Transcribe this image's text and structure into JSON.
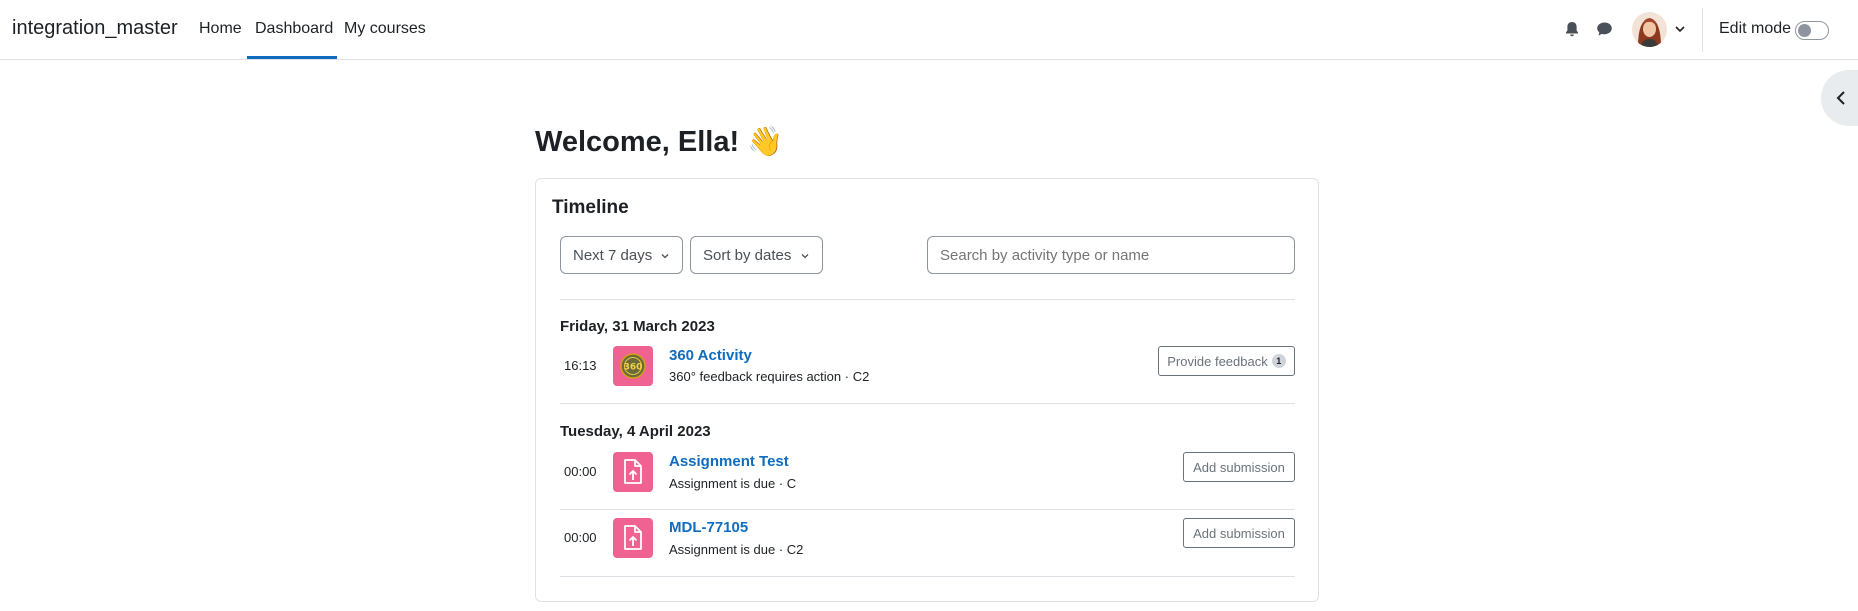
{
  "navbar": {
    "brand": "integration_master",
    "links": [
      "Home",
      "Dashboard",
      "My courses"
    ],
    "active_link": "Dashboard",
    "edit_mode_label": "Edit mode",
    "edit_mode_on": false
  },
  "main": {
    "welcome": "Welcome, Ella! 👋"
  },
  "timeline": {
    "title": "Timeline",
    "filter_days": "Next 7 days",
    "sort_by": "Sort by dates",
    "search_placeholder": "Search by activity type or name",
    "groups": [
      {
        "date": "Friday, 31 March 2023",
        "items": [
          {
            "time": "16:13",
            "icon": "360-feedback-icon",
            "name": "360 Activity",
            "description": "360° feedback requires action · C2",
            "action": "Provide feedback",
            "badge": "1"
          }
        ]
      },
      {
        "date": "Tuesday, 4 April 2023",
        "items": [
          {
            "time": "00:00",
            "icon": "assignment-upload-icon",
            "name": "Assignment Test",
            "description": "Assignment is due · C",
            "action": "Add submission"
          },
          {
            "time": "00:00",
            "icon": "assignment-upload-icon",
            "name": "MDL-77105",
            "description": "Assignment is due · C2",
            "action": "Add submission"
          }
        ]
      }
    ]
  },
  "colors": {
    "accent": "#0f6cbf",
    "activity_icon_bg": "#f06292"
  }
}
